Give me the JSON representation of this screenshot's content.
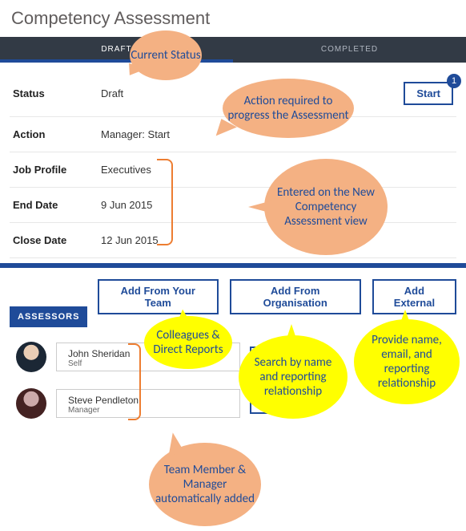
{
  "page_title": "Competency Assessment",
  "tabs": {
    "draft": "DRAFT",
    "completed": "COMPLETED"
  },
  "details": {
    "status_label": "Status",
    "status_value": "Draft",
    "action_label": "Action",
    "action_value": "Manager: Start",
    "job_label": "Job Profile",
    "job_value": "Executives",
    "end_label": "End Date",
    "end_value": "9 Jun 2015",
    "close_label": "Close Date",
    "close_value": "12 Jun 2015"
  },
  "start_button": "Start",
  "start_badge": "1",
  "assessors": {
    "heading": "ASSESSORS",
    "add_team": "Add From Your Team",
    "add_org": "Add From Organisation",
    "add_ext": "Add External",
    "delete": "Delete",
    "items": [
      {
        "name": "John Sheridan",
        "role": "Self"
      },
      {
        "name": "Steve Pendleton",
        "role": "Manager"
      }
    ]
  },
  "callouts": {
    "current_status": "Current Status",
    "action_req": "Action required to progress the Assessment",
    "entered": "Entered on the New Competency Assessment view",
    "colleagues": "Colleagues & Direct Reports",
    "search_org": "Search by name and reporting relationship",
    "provide": "Provide name, email, and reporting relationship",
    "auto_added": "Team Member & Manager automatically added"
  }
}
